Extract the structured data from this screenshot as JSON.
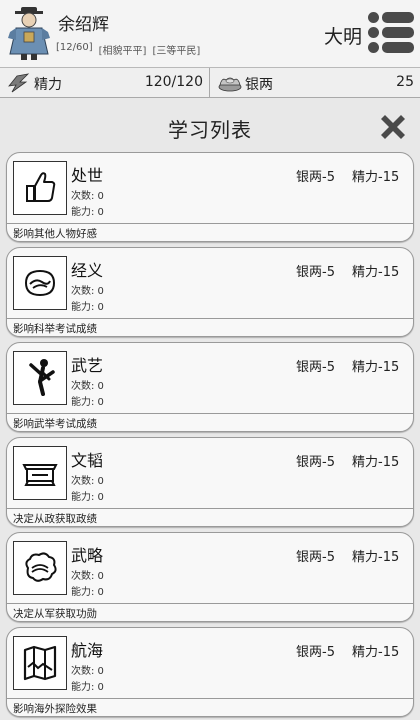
{
  "player": {
    "name": "余绍辉",
    "tags": [
      "[12/60]",
      "[相貌平平]",
      "[三等平民]"
    ],
    "dynasty": "大明"
  },
  "resources": {
    "energy_label": "精力",
    "energy_value": "120/120",
    "silver_label": "银两",
    "silver_value": "25"
  },
  "panel": {
    "title": "学习列表"
  },
  "items": [
    {
      "title": "处世",
      "times": "次数: 0",
      "ability": "能力: 0",
      "silver_cost": "银两-5",
      "energy_cost": "精力-15",
      "desc": "影响其他人物好感",
      "icon": "thumbs-up-icon"
    },
    {
      "title": "经义",
      "times": "次数: 0",
      "ability": "能力: 0",
      "silver_cost": "银两-5",
      "energy_cost": "精力-15",
      "desc": "影响科举考试成绩",
      "icon": "classic-swirl-icon"
    },
    {
      "title": "武艺",
      "times": "次数: 0",
      "ability": "能力: 0",
      "silver_cost": "银两-5",
      "energy_cost": "精力-15",
      "desc": "影响武举考试成绩",
      "icon": "martial-kick-icon"
    },
    {
      "title": "文韬",
      "times": "次数: 0",
      "ability": "能力: 0",
      "silver_cost": "银两-5",
      "energy_cost": "精力-15",
      "desc": "决定从政获取政绩",
      "icon": "official-hat-icon"
    },
    {
      "title": "武略",
      "times": "次数: 0",
      "ability": "能力: 0",
      "silver_cost": "银两-5",
      "energy_cost": "精力-15",
      "desc": "决定从军获取功勋",
      "icon": "strategy-cloud-icon"
    },
    {
      "title": "航海",
      "times": "次数: 0",
      "ability": "能力: 0",
      "silver_cost": "银两-5",
      "energy_cost": "精力-15",
      "desc": "影响海外探险效果",
      "icon": "sea-map-icon"
    }
  ]
}
